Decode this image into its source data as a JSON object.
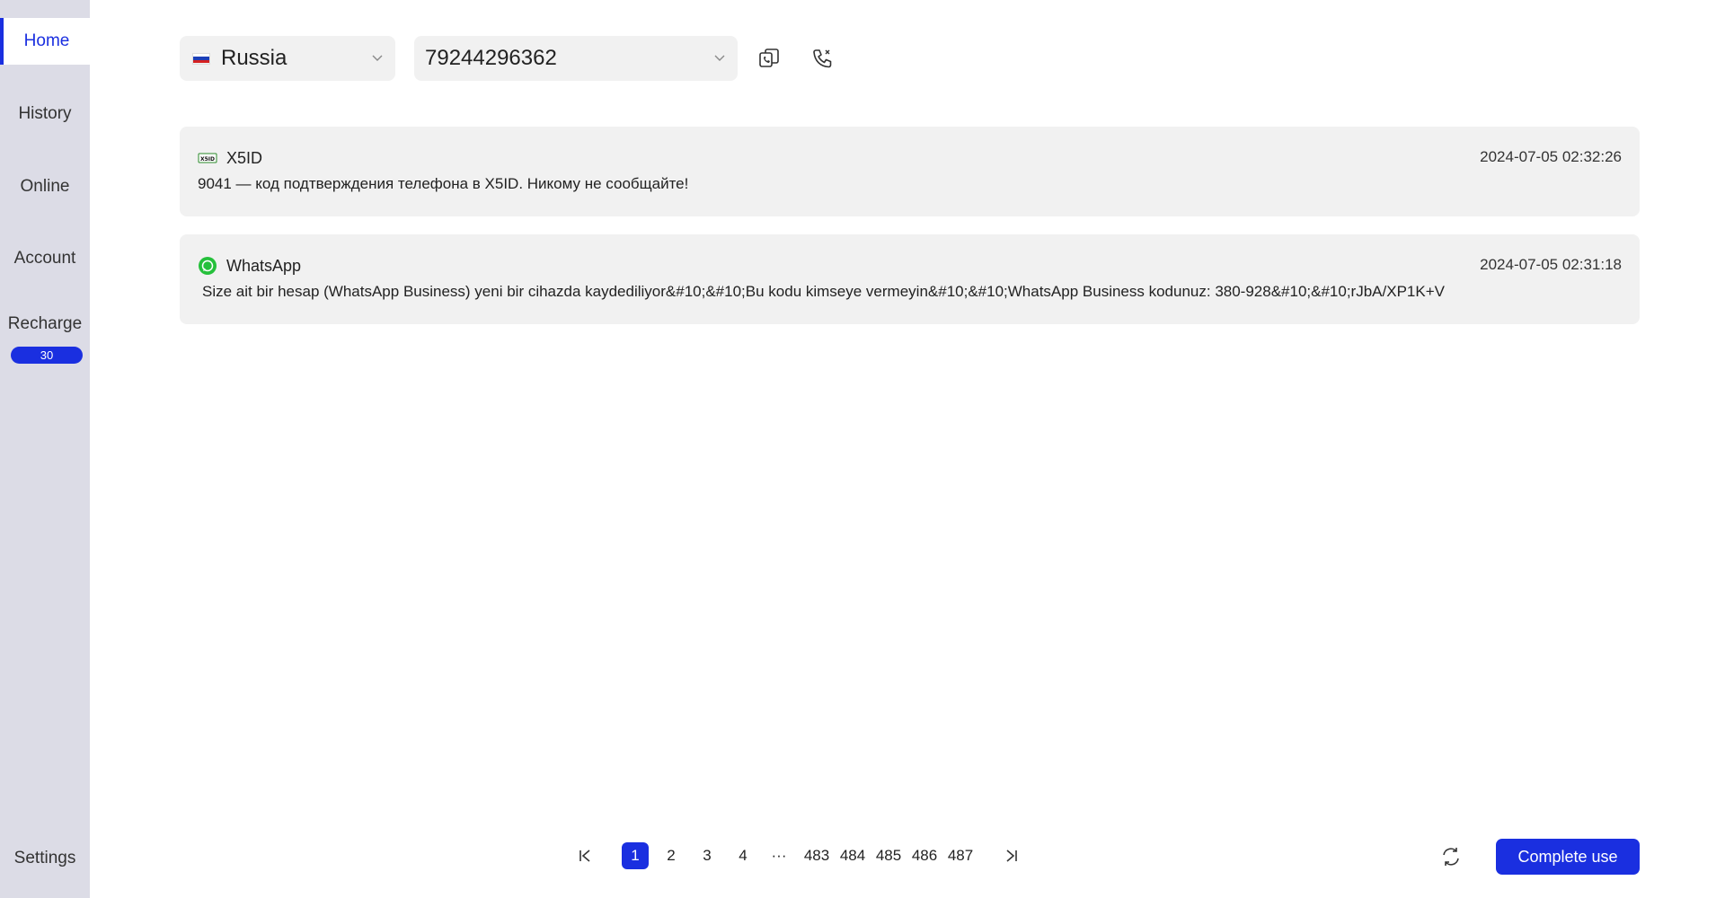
{
  "sidebar": {
    "items": [
      {
        "label": "Home",
        "active": true
      },
      {
        "label": "History"
      },
      {
        "label": "Online"
      },
      {
        "label": "Account"
      },
      {
        "label": "Recharge"
      },
      {
        "label": "Settings"
      }
    ],
    "recharge_badge": "30"
  },
  "top": {
    "country": "Russia",
    "number": "79244296362",
    "icons": [
      "copy-phone-icon",
      "call-icon"
    ]
  },
  "messages": [
    {
      "app": "X5ID",
      "icon": "x5id-logo-icon",
      "time": "2024-07-05 02:32:26",
      "text": "9041 — код подтверждения телефона в X5ID. Никому не сообщайте!"
    },
    {
      "app": "WhatsApp",
      "icon": "whatsapp-icon",
      "time": "2024-07-05 02:31:18",
      "text": "Size ait bir hesap (WhatsApp Business) yeni bir cihazda kaydediliyor&#10;&#10;Bu kodu kimseye vermeyin&#10;&#10;WhatsApp Business kodunuz: 380-928&#10;&#10;rJbA/XP1K+V"
    }
  ],
  "pagination": {
    "pages": [
      "1",
      "2",
      "3",
      "4",
      "···",
      "483",
      "484",
      "485",
      "486",
      "487"
    ],
    "current": "1"
  },
  "actions": {
    "complete_label": "Complete use"
  },
  "colors": {
    "accent": "#1a2fe0",
    "sidebar_bg": "#dcdce6",
    "card_bg": "#f1f1f1"
  }
}
